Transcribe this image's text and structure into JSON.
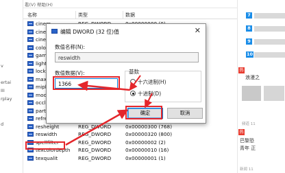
{
  "menu": {
    "item1": "看(V)",
    "item2": "帮助(H)"
  },
  "left_tree": [
    "v",
    "ertai",
    "III",
    "rplay",
    "d"
  ],
  "list": {
    "headers": [
      "名称",
      "类型",
      "数据"
    ],
    "rows": [
      {
        "name": "cinem",
        "type": "REG_DWORD",
        "data": "0x00000000 (0)"
      },
      {
        "name": "cinem",
        "type": "",
        "data": ""
      },
      {
        "name": "cinem",
        "type": "",
        "data": ""
      },
      {
        "name": "colore",
        "type": "",
        "data": ""
      },
      {
        "name": "gamn",
        "type": "",
        "data": ""
      },
      {
        "name": "lights",
        "type": "",
        "data": ""
      },
      {
        "name": "lockft",
        "type": "",
        "data": ""
      },
      {
        "name": "maxfp",
        "type": "",
        "data": ""
      },
      {
        "name": "mipler",
        "type": "",
        "data": ""
      },
      {
        "name": "mode",
        "type": "",
        "data": ""
      },
      {
        "name": "occlus",
        "type": "",
        "data": ""
      },
      {
        "name": "partic",
        "type": "",
        "data": ""
      },
      {
        "name": "refreshrate",
        "type": "REG_DWORD",
        "data": "0x0000004b (75)"
      },
      {
        "name": "resheight",
        "type": "REG_DWORD",
        "data": "0x00000300 (768)"
      },
      {
        "name": "reswidth",
        "type": "REG_DWORD",
        "data": "0x00000320 (800)"
      },
      {
        "name": "spellfilter",
        "type": "REG_DWORD",
        "data": "0x00000002 (2)"
      },
      {
        "name": "texcolordepth",
        "type": "REG_DWORD",
        "data": "0x00000010 (16)"
      },
      {
        "name": "texqualit",
        "type": "REG_DWORD",
        "data": "0x00000001 (1)"
      }
    ]
  },
  "dialog": {
    "title": "编辑 DWORD (32 位)值",
    "close": "✕",
    "value_name_label": "数值名称(N):",
    "value_name": "reswidth",
    "value_data_label": "数值数据(V):",
    "value_data": "1366",
    "base_label": "基数",
    "hex_label": "十六进制(H)",
    "dec_label": "十进制(D)",
    "ok": "确定",
    "cancel": "取消"
  },
  "right_pane": {
    "numbers": [
      "7",
      "8",
      "9",
      "10"
    ],
    "hot_badge": "热",
    "item1": "浪漫之",
    "meta1": "频道 11",
    "item2": "巴黎恐",
    "item2b": "青年 正",
    "meta2": "新闻 11"
  },
  "colors": {
    "accent_red": "#e4262b",
    "num_blue": "#1a8de8",
    "hot_red": "#e83b2f"
  }
}
